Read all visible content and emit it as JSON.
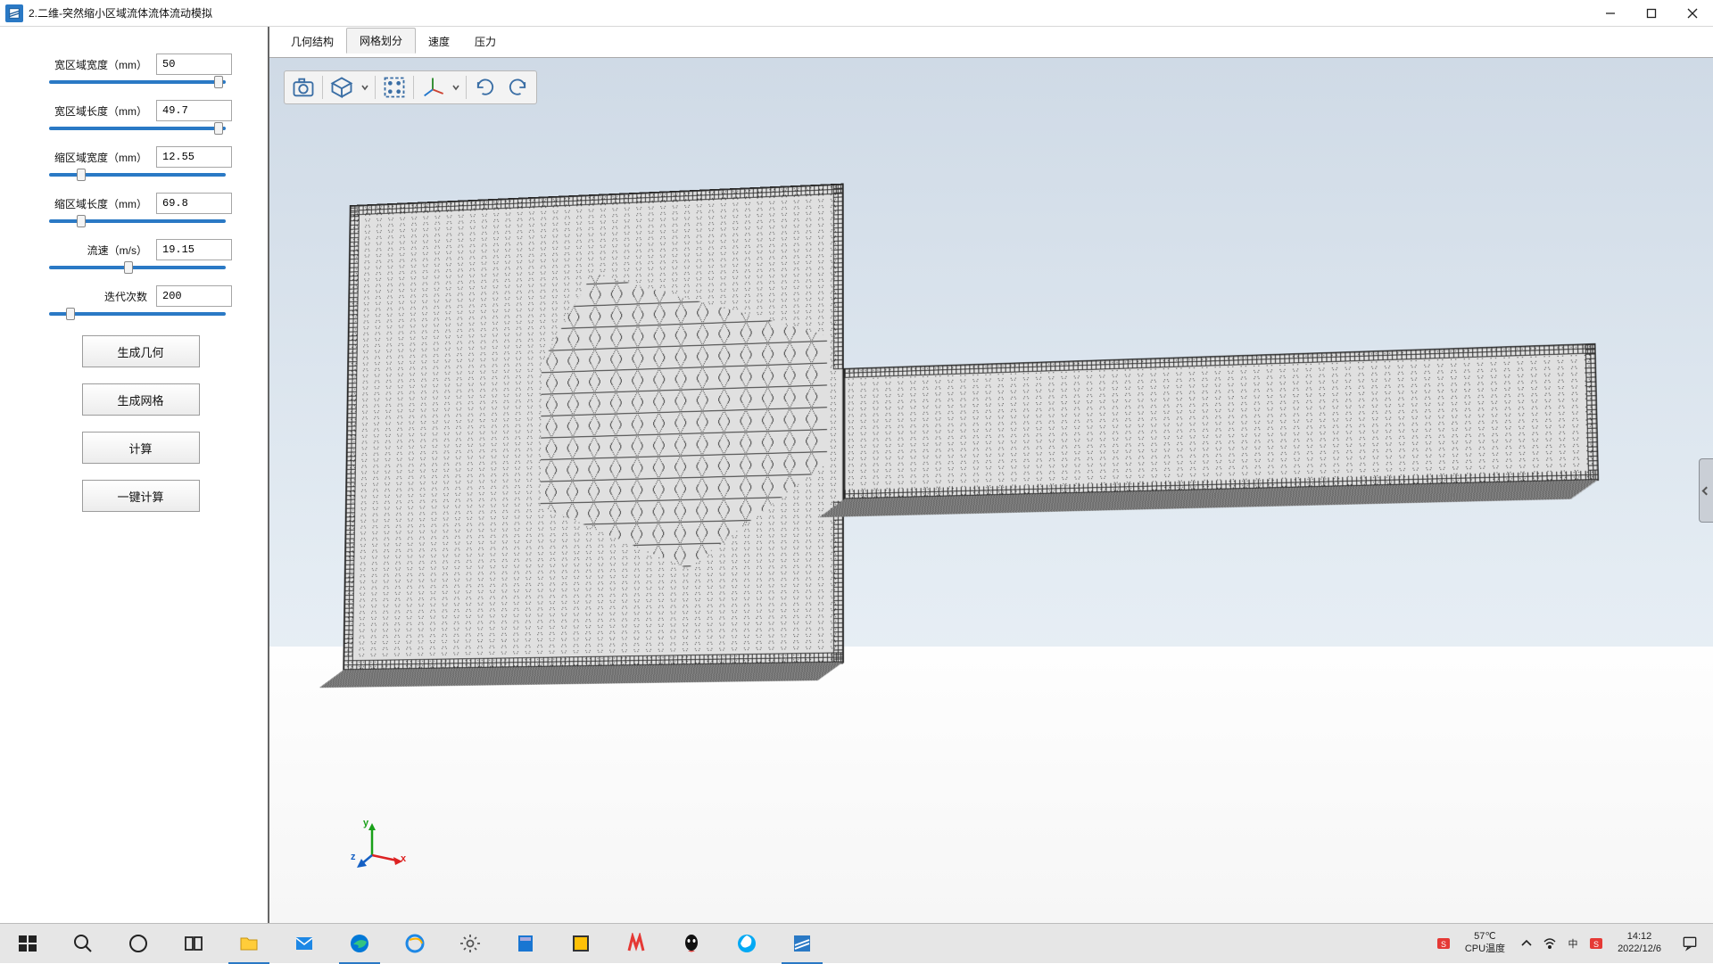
{
  "window": {
    "title": "2.二维-突然缩小区域流体流体流动模拟"
  },
  "params": [
    {
      "label": "宽区域宽度（mm）",
      "value": "50",
      "knob_pct": 96
    },
    {
      "label": "宽区域长度（mm）",
      "value": "49.7",
      "knob_pct": 96
    },
    {
      "label": "缩区域宽度（mm）",
      "value": "12.55",
      "knob_pct": 18
    },
    {
      "label": "缩区域长度（mm）",
      "value": "69.8",
      "knob_pct": 18
    },
    {
      "label": "流速（m/s）",
      "value": "19.15",
      "knob_pct": 45
    },
    {
      "label": "迭代次数",
      "value": "200",
      "knob_pct": 12
    }
  ],
  "buttons": {
    "generate_geometry": "生成几何",
    "generate_mesh": "生成网格",
    "compute": "计算",
    "one_click_compute": "一键计算"
  },
  "tabs": [
    {
      "label": "几何结构",
      "active": false
    },
    {
      "label": "网格划分",
      "active": true
    },
    {
      "label": "速度",
      "active": false
    },
    {
      "label": "压力",
      "active": false
    }
  ],
  "view_toolbar": {
    "camera": "camera-icon",
    "cube": "view-cube-icon",
    "fit": "fit-view-icon",
    "axes": "axes-icon",
    "rotate_cw": "rotate-cw-icon",
    "rotate_ccw": "rotate-ccw-icon"
  },
  "axes": {
    "x": "x",
    "y": "y",
    "z": "z"
  },
  "taskbar": {
    "temp_value": "57℃",
    "temp_label": "CPU温度",
    "time": "14:12",
    "date": "2022/12/6"
  }
}
